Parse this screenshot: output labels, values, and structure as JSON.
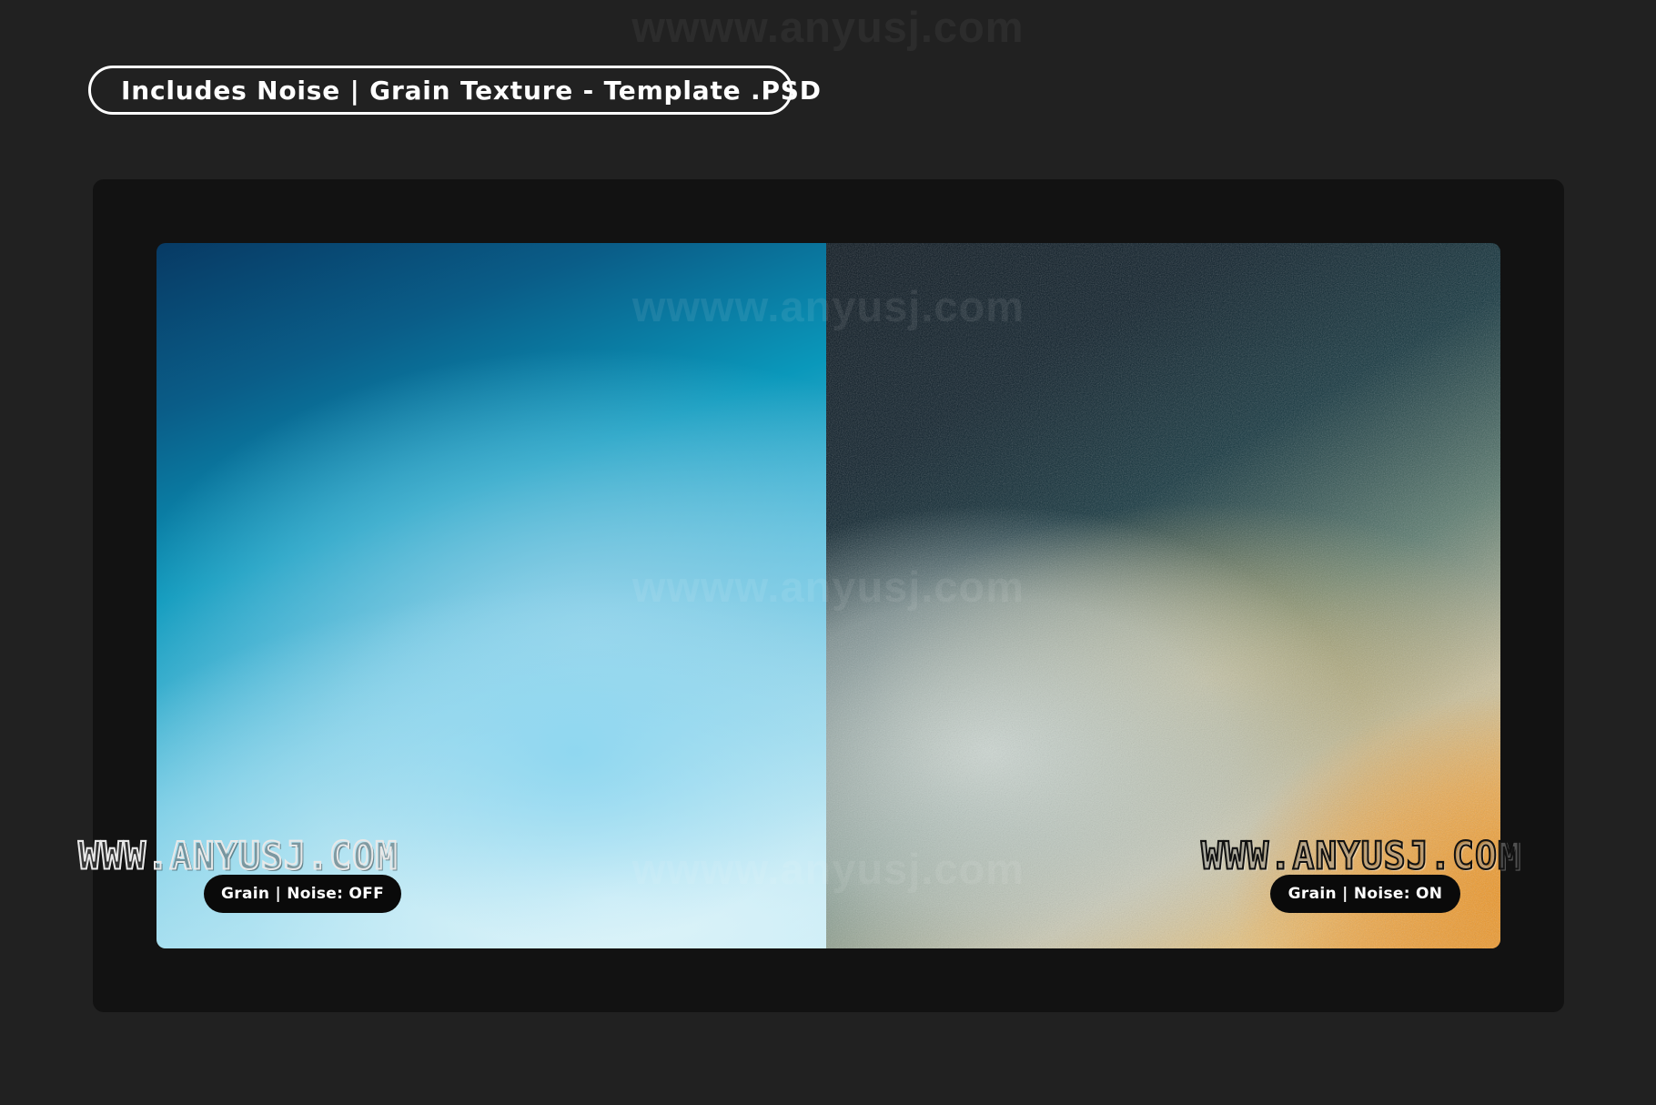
{
  "watermark": {
    "text": "wwww.anyusj.com",
    "corner_text": "WWW.ANYUSJ.COM"
  },
  "header": {
    "title": "Includes Noise | Grain Texture - Template .PSD"
  },
  "comparison": {
    "left_label": "Grain | Noise: OFF",
    "right_label": "Grain | Noise: ON"
  },
  "colors": {
    "background": "#212121",
    "frame": "#121212",
    "pill": "#0a0a0a",
    "accent_blue": "#0a98bb",
    "accent_orange": "#ee9a2c"
  }
}
